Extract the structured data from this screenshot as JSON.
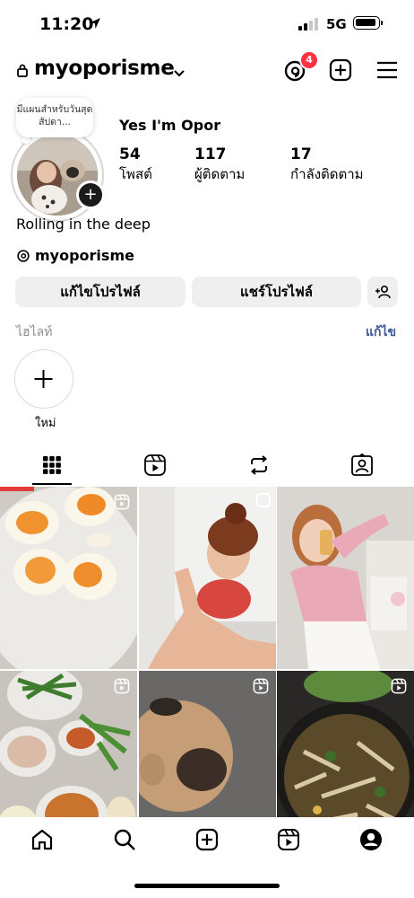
{
  "status_bar": {
    "time": "11:20",
    "network": "5G"
  },
  "header": {
    "username": "myoporisme",
    "notification_count": "4"
  },
  "profile": {
    "note": "มีแผนสำหรับวันสุดสัปดา...",
    "display_name": "Yes I'm Opor",
    "stats": [
      {
        "value": "54",
        "label": "โพสต์"
      },
      {
        "value": "117",
        "label": "ผู้ติดตาม"
      },
      {
        "value": "17",
        "label": "กำลังติดตาม"
      }
    ],
    "bio": "Rolling in the deep",
    "threads_handle": "myoporisme"
  },
  "actions": {
    "edit_profile": "แก้ไขโปรไฟล์",
    "share_profile": "แชร์โปรไฟล์"
  },
  "highlights": {
    "title": "ไฮไลท์",
    "edit": "แก้ไข",
    "new_label": "ใหม่"
  },
  "tabs": [
    "grid-icon",
    "reels-icon",
    "reposts-icon",
    "tagged-icon"
  ],
  "posts": [
    {
      "name": "post-eggs",
      "reel": true
    },
    {
      "name": "post-workout",
      "reel": false,
      "multi": true
    },
    {
      "name": "post-mirror-selfie",
      "reel": false
    },
    {
      "name": "post-food-prep",
      "reel": true
    },
    {
      "name": "post-pug",
      "reel": true
    },
    {
      "name": "post-stew",
      "reel": true
    }
  ],
  "bottom_nav": [
    "home-icon",
    "search-icon",
    "create-icon",
    "reels-icon",
    "profile-icon"
  ],
  "colors": {
    "badge": "#ff3040",
    "button_bg": "#efefef",
    "link": "#3b5998"
  }
}
